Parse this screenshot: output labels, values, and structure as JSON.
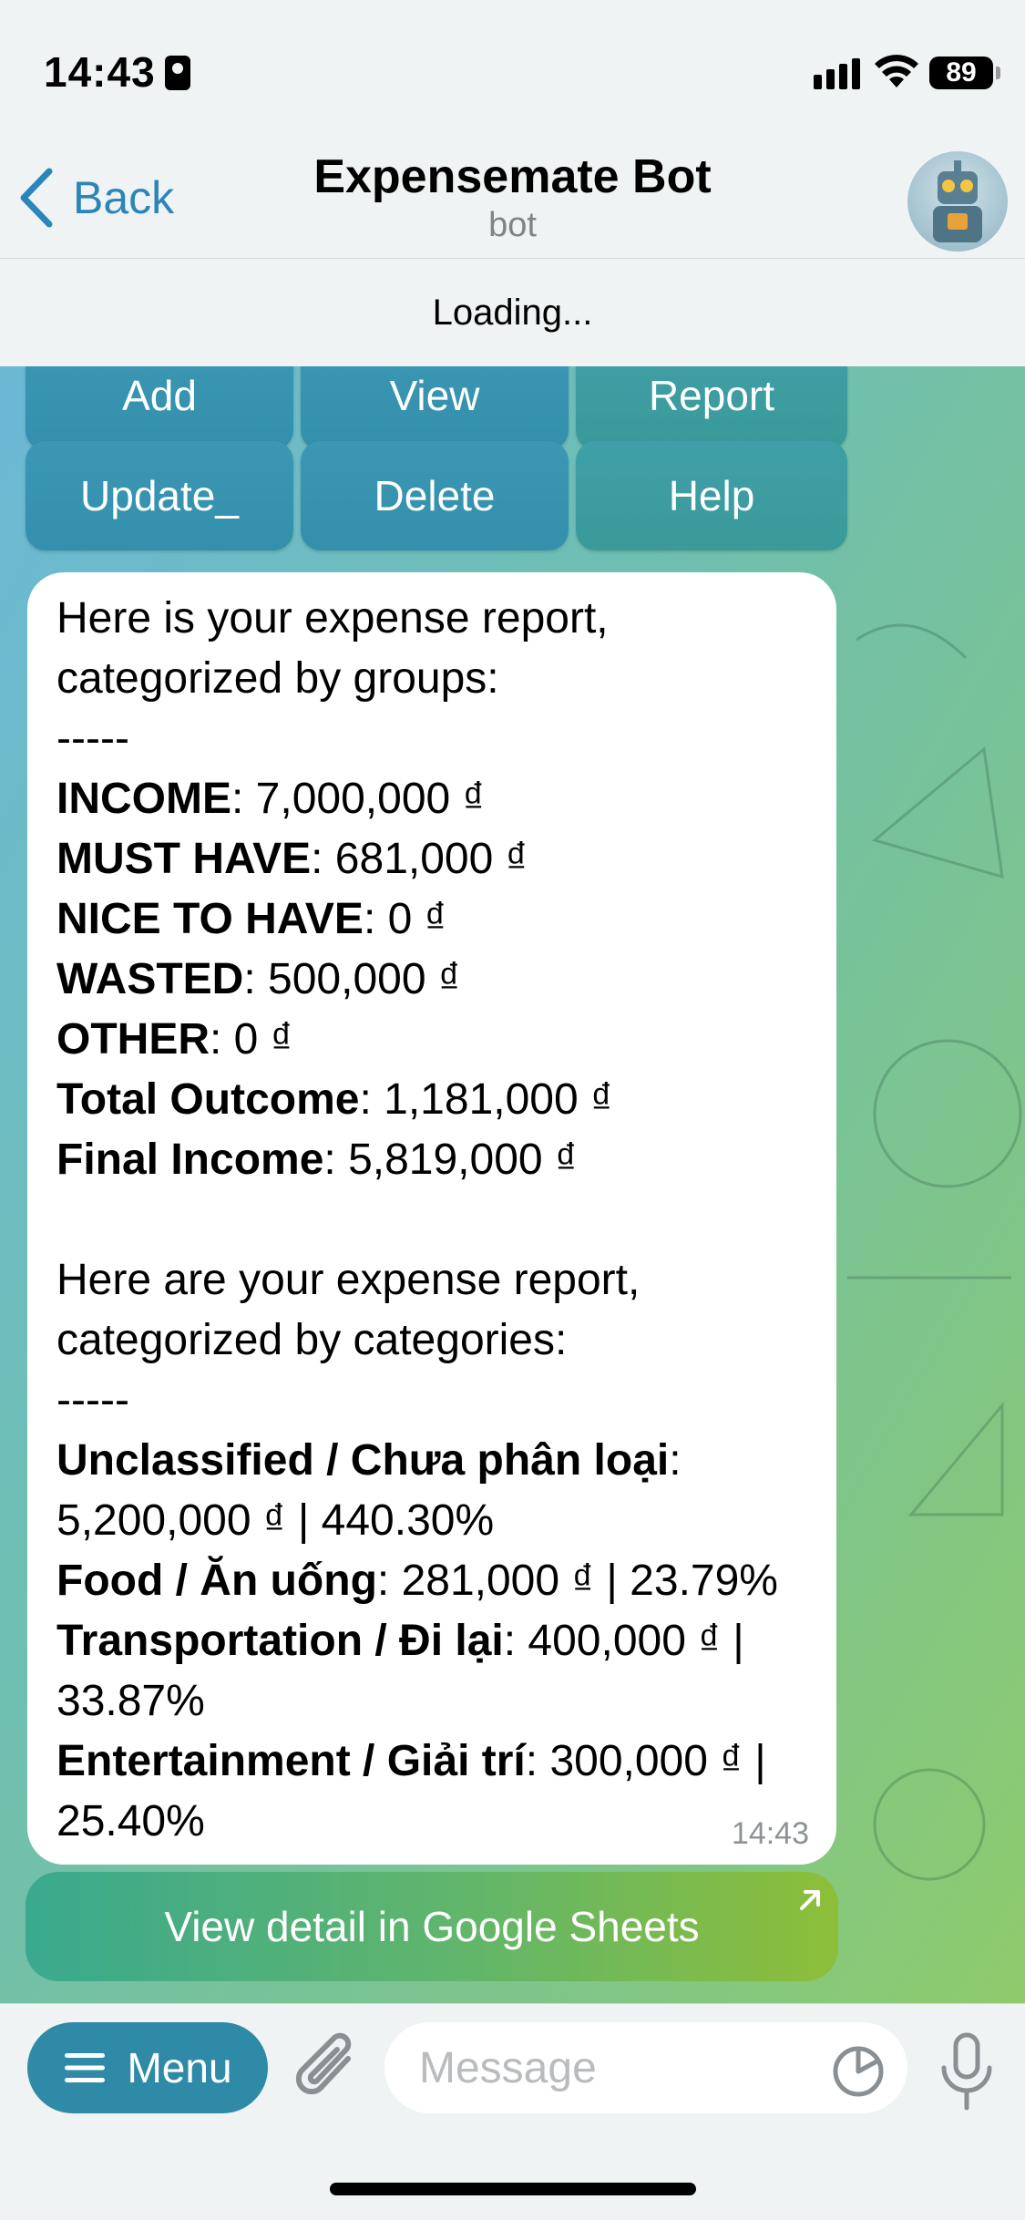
{
  "status_bar": {
    "time": "14:43",
    "battery": "89"
  },
  "header": {
    "back_label": "Back",
    "title": "Expensemate Bot",
    "subtitle": "bot"
  },
  "loading_text": "Loading...",
  "keyboard": {
    "row1": [
      "Add",
      "View",
      "Report"
    ],
    "row2": [
      "Update_",
      "Delete",
      "Help"
    ]
  },
  "message": {
    "intro1": "Here is your expense report,\ncategorized by groups:\n-----",
    "groups": [
      {
        "label": "INCOME",
        "value": ": 7,000,000 ₫"
      },
      {
        "label": "MUST HAVE",
        "value": ": 681,000 ₫"
      },
      {
        "label": "NICE TO HAVE",
        "value": ": 0 ₫"
      },
      {
        "label": "WASTED",
        "value": ": 500,000 ₫"
      },
      {
        "label": "OTHER",
        "value": ": 0 ₫"
      },
      {
        "label": "Total Outcome",
        "value": ": 1,181,000 ₫"
      },
      {
        "label": "Final Income",
        "value": ": 5,819,000 ₫"
      }
    ],
    "intro2": "Here are your expense report,\ncategorized by categories:\n-----",
    "categories": [
      {
        "label": "Unclassified / Chưa phân loại",
        "value": ":\n5,200,000 ₫ | 440.30%"
      },
      {
        "label": "Food / Ăn uống",
        "value": ": 281,000 ₫ | 23.79%"
      },
      {
        "label": "Transportation / Đi lại",
        "value": ": 400,000 ₫ |\n33.87%"
      },
      {
        "label": "Entertainment / Giải trí",
        "value": ": 300,000 ₫ |\n25.40%"
      }
    ],
    "time": "14:43"
  },
  "inline_button": {
    "label": "View detail in Google Sheets"
  },
  "input_bar": {
    "menu_label": "Menu",
    "message_placeholder": "Message"
  },
  "colors": {
    "accent": "#2e8aa6",
    "link": "#2a86b8",
    "keyboard_button": "#3390ac"
  }
}
